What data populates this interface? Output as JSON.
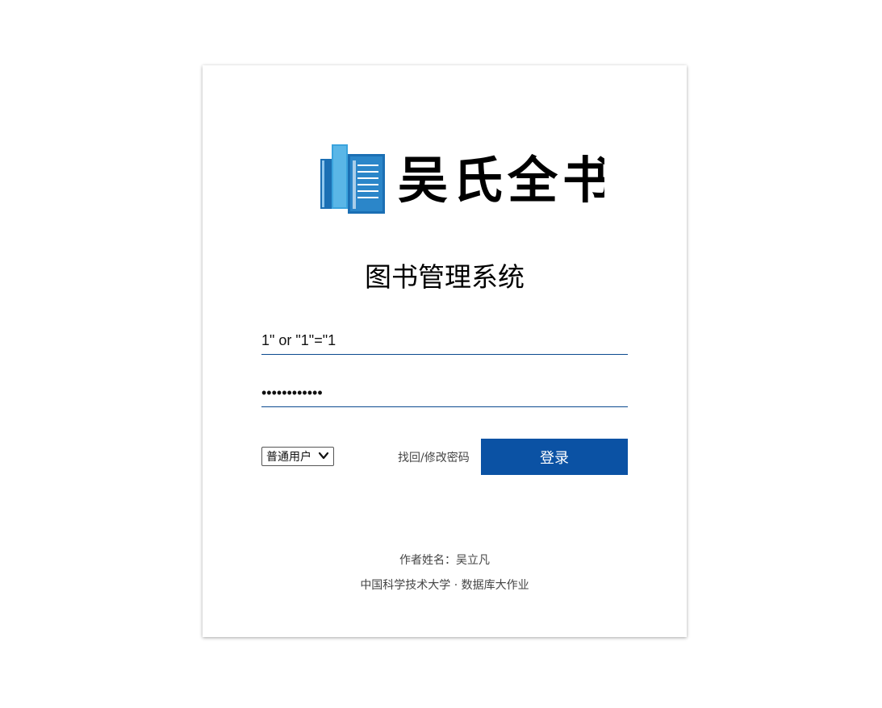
{
  "logo": {
    "brand_text": "吴氏全书",
    "icon": "books-icon",
    "colors": {
      "dark_blue": "#1b6fb4",
      "light_blue": "#3aa3dd",
      "ink": "#000000"
    }
  },
  "title": "图书管理系统",
  "form": {
    "username_value": "1\" or \"1\"=\"1",
    "password_value": "••••••••••••",
    "role_selected": "普通用户",
    "forgot_label": "找回/修改密码",
    "login_label": "登录"
  },
  "footer": {
    "author": "作者姓名：吴立凡",
    "school": "中国科学技术大学 · 数据库大作业"
  },
  "colors": {
    "accent": "#0b52a4",
    "underline": "#0b4a8f"
  }
}
